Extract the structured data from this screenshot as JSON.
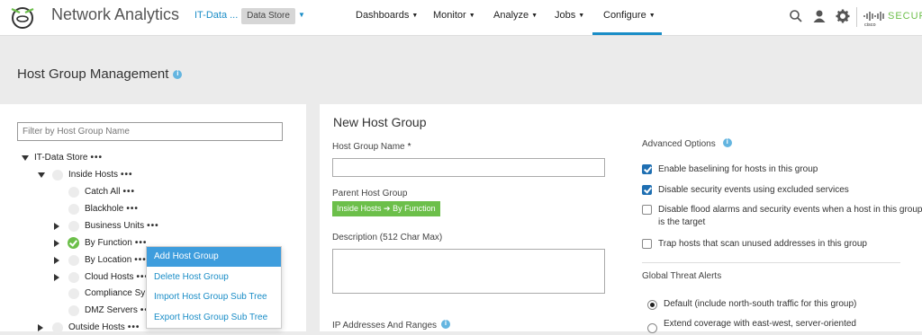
{
  "header": {
    "app_title": "Network Analytics",
    "tenant": "IT-Data ...",
    "data_store": "Data Store",
    "nav": [
      {
        "label": "Dashboards"
      },
      {
        "label": "Monitor"
      },
      {
        "label": "Analyze"
      },
      {
        "label": "Jobs"
      },
      {
        "label": "Configure"
      }
    ],
    "active_nav": "Configure",
    "brand": "SECUR",
    "icons": [
      "search-icon",
      "user-icon",
      "gear-icon",
      "cisco-logo"
    ],
    "accent_color": "#1a8dc7"
  },
  "page": {
    "title": "Host Group Management"
  },
  "tree": {
    "filter_placeholder": "Filter by Host Group Name",
    "dots": "•••",
    "nodes": [
      {
        "label": "IT-Data Store"
      },
      {
        "label": "Inside Hosts"
      },
      {
        "label": "Catch All"
      },
      {
        "label": "Blackhole"
      },
      {
        "label": "Business Units"
      },
      {
        "label": "By Function"
      },
      {
        "label": "By Location"
      },
      {
        "label": "Cloud Hosts"
      },
      {
        "label": "Compliance Sy"
      },
      {
        "label": "DMZ Servers"
      },
      {
        "label": "Outside Hosts"
      }
    ]
  },
  "context_menu": {
    "items": [
      {
        "label": "Add Host Group"
      },
      {
        "label": "Delete Host Group"
      },
      {
        "label": "Import Host Group Sub Tree"
      },
      {
        "label": "Export Host Group Sub Tree"
      }
    ],
    "highlighted": "Add Host Group"
  },
  "form": {
    "title": "New Host Group",
    "name_label": "Host Group Name",
    "required_mark": "*",
    "name_value": "",
    "parent_label": "Parent Host Group",
    "parent_path": "Inside Hosts ➔ By Function",
    "description_label": "Description (512 Char Max)",
    "description_value": "",
    "ip_label": "IP Addresses And Ranges"
  },
  "advanced": {
    "title": "Advanced Options",
    "options": [
      {
        "label": "Enable baselining for hosts in this group",
        "checked": true
      },
      {
        "label": "Disable security events using excluded services",
        "checked": true
      },
      {
        "label": "Disable flood alarms and security events when a host in this group is the target",
        "checked": false
      },
      {
        "label": "Trap hosts that scan unused addresses in this group",
        "checked": false
      }
    ]
  },
  "threat_alerts": {
    "title": "Global Threat Alerts",
    "options": [
      {
        "label": "Default (include north-south traffic for this group)",
        "selected": true
      },
      {
        "label": "Extend coverage with east-west, server-oriented",
        "selected": false
      }
    ]
  }
}
